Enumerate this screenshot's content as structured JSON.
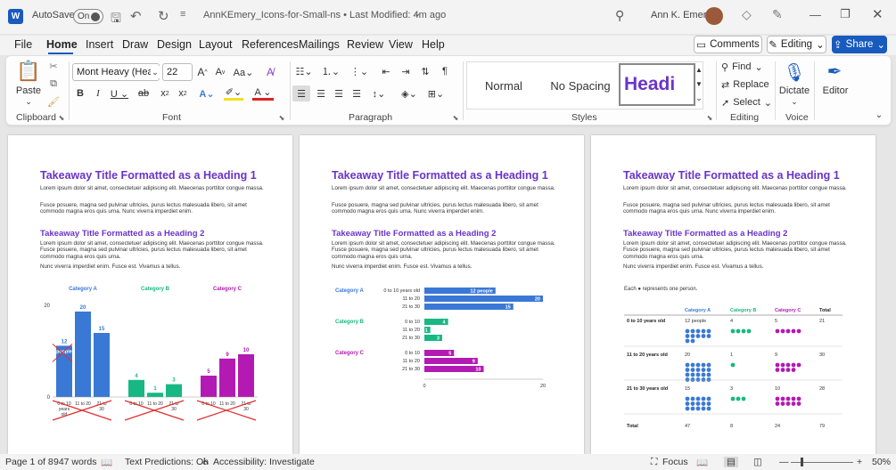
{
  "titlebar": {
    "autosave_label": "AutoSave",
    "autosave_state": "On",
    "doc_title": "AnnKEmery_Icons-for-Small-ns • Last Modified: 4m ago",
    "user_name": "Ann K. Emery"
  },
  "tabs": [
    "File",
    "Home",
    "Insert",
    "Draw",
    "Design",
    "Layout",
    "References",
    "Mailings",
    "Review",
    "View",
    "Help"
  ],
  "active_tab": "Home",
  "actions": {
    "comments": "Comments",
    "editing": "Editing",
    "share": "Share"
  },
  "ribbon": {
    "clipboard": {
      "paste": "Paste",
      "group": "Clipboard"
    },
    "font": {
      "family": "Mont Heavy (Headin",
      "size": "22",
      "group": "Font"
    },
    "paragraph": {
      "group": "Paragraph"
    },
    "styles": {
      "items": [
        "Normal",
        "No Spacing",
        "Headi"
      ],
      "group": "Styles"
    },
    "editing": {
      "find": "Find",
      "replace": "Replace",
      "select": "Select",
      "group": "Editing"
    },
    "voice": {
      "dictate": "Dictate",
      "group": "Voice"
    },
    "editor": {
      "label": "Editor"
    }
  },
  "doc": {
    "h1": "Takeaway Title Formatted as a Heading 1",
    "p1": "Lorem ipsum dolor sit amet, consectetuer adipiscing elit. Maecenas porttitor congue massa.",
    "p2": "Fusce posuere, magna sed pulvinar ultricies, purus lectus malesuada libero, sit amet commodo magna eros quis urna. Nunc viverra imperdiet enim.",
    "h2": "Takeaway Title Formatted as a Heading 2",
    "p3": "Lorem ipsum dolor sit amet, consectetuer adipiscing elit. Maecenas porttitor congue massa. Fusce posuere, magna sed pulvinar ultricies, purus lectus malesuada libero, sit amet commodo magna eros quis urna.",
    "p4": "Nunc viverra imperdiet enim. Fusce est. Vivamus a tellus."
  },
  "colors": {
    "cat_a": "#3a78d6",
    "cat_b": "#17b883",
    "cat_c": "#b31ab3",
    "heading": "#6a34c8",
    "word_blue": "#185abd"
  },
  "page1_chart": {
    "categories": [
      "Category A",
      "Category B",
      "Category C"
    ],
    "groups": [
      "0 to 10 years old",
      "11 to 20",
      "21 to 30"
    ],
    "values": [
      [
        12,
        20,
        15
      ],
      [
        4,
        1,
        3
      ],
      [
        5,
        9,
        10
      ]
    ],
    "tick_top": "20",
    "tick_bottom": "0",
    "x_labels": [
      [
        "0 to 10",
        "years",
        "old",
        "11 to 20",
        "21 to",
        "30"
      ],
      [
        "0 to 10",
        "11 to 20",
        "21 to",
        "30"
      ],
      [
        "0 to 10",
        "11 to 20",
        "21 to",
        "30"
      ]
    ],
    "annotation": "people"
  },
  "page2_chart": {
    "rows": [
      {
        "category": "Category A",
        "bars": [
          {
            "label": "0 to 10 years old",
            "value": 12,
            "text": "12 people"
          },
          {
            "label": "11 to 20",
            "value": 20,
            "text": "20"
          },
          {
            "label": "21 to 30",
            "value": 15,
            "text": "15"
          }
        ]
      },
      {
        "category": "Category B",
        "bars": [
          {
            "label": "0 to 10",
            "value": 4,
            "text": "4"
          },
          {
            "label": "11 to 20",
            "value": 1,
            "text": "1"
          },
          {
            "label": "21 to 30",
            "value": 3,
            "text": "3"
          }
        ]
      },
      {
        "category": "Category C",
        "bars": [
          {
            "label": "0 to 10",
            "value": 5,
            "text": "5"
          },
          {
            "label": "11 to 20",
            "value": 9,
            "text": "9"
          },
          {
            "label": "21 to 30",
            "value": 10,
            "text": "10"
          }
        ]
      }
    ],
    "axis": [
      "0",
      "20"
    ]
  },
  "page3_table": {
    "note": "Each ● represents one person.",
    "headers": [
      "Category A",
      "Category B",
      "Category C",
      "Total"
    ],
    "rows": [
      {
        "label": "0 to 10 years old",
        "cells": [
          "12 people",
          "4",
          "5",
          "21"
        ],
        "dots": [
          12,
          4,
          5
        ]
      },
      {
        "label": "11 to 20 years old",
        "cells": [
          "20",
          "1",
          "9",
          "30"
        ],
        "dots": [
          20,
          1,
          9
        ]
      },
      {
        "label": "21 to 30 years old",
        "cells": [
          "15",
          "3",
          "10",
          "28"
        ],
        "dots": [
          15,
          3,
          10
        ]
      }
    ],
    "total": {
      "label": "Total",
      "cells": [
        "47",
        "8",
        "24",
        "79"
      ]
    }
  },
  "status": {
    "page": "Page 1 of 8",
    "words": "947 words",
    "predictions": "Text Predictions: On",
    "accessibility": "Accessibility: Investigate",
    "focus": "Focus",
    "zoom": "50%"
  }
}
